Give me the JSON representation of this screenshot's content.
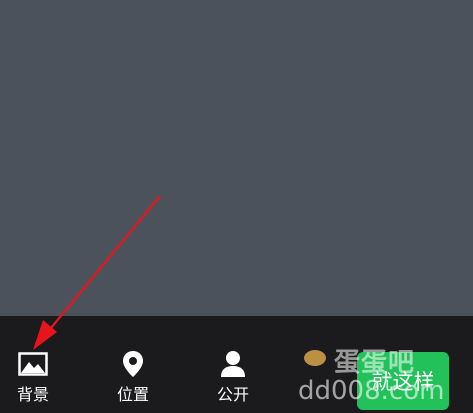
{
  "toolbar": {
    "items": [
      {
        "label": "背景",
        "icon": "image-icon"
      },
      {
        "label": "位置",
        "icon": "location-pin-icon"
      },
      {
        "label": "公开",
        "icon": "person-icon"
      }
    ],
    "done_label": "就这样"
  },
  "watermark": {
    "title": "蛋蛋吧",
    "url": "dd008.com"
  },
  "colors": {
    "canvas": "#4b525c",
    "toolbar": "#1b1b1d",
    "accent": "#22c15a",
    "arrow": "#e8141c"
  }
}
